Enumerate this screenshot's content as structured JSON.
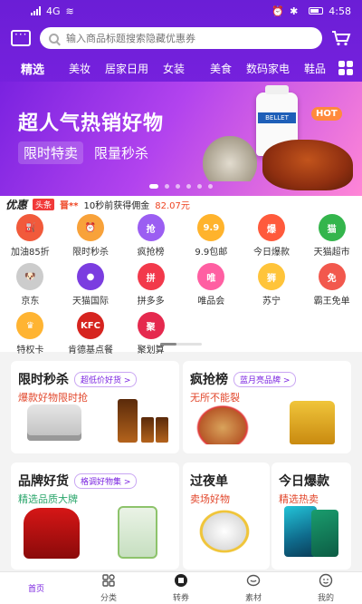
{
  "status": {
    "network": "4G",
    "battery": "",
    "time": "4:58"
  },
  "search": {
    "placeholder": "输入商品标题搜索隐藏优惠券"
  },
  "categories": [
    "精选",
    "美妆",
    "居家日用",
    "女装",
    "美食",
    "数码家电",
    "鞋品"
  ],
  "banner": {
    "title": "超人气热销好物",
    "sub1": "限时特卖",
    "sub2": "限量秒杀",
    "bottle_label": "BELLET",
    "hot": "HOT"
  },
  "notice": {
    "brand": "优惠",
    "tag": "头条",
    "user": "晋**",
    "text": "10秒前获得佣金",
    "amount": "82.07元"
  },
  "icons": [
    {
      "label": "加油85折",
      "color": "#f15a3b",
      "glyph": "⛽"
    },
    {
      "label": "限时秒杀",
      "color": "#f8a23a",
      "glyph": "⏰"
    },
    {
      "label": "疯抢榜",
      "color": "#9b5ef2",
      "glyph": "抢"
    },
    {
      "label": "9.9包邮",
      "color": "#ffb32c",
      "glyph": "9.9"
    },
    {
      "label": "今日爆款",
      "color": "#ff5a3c",
      "glyph": "爆"
    },
    {
      "label": "天猫超市",
      "color": "#34b54c",
      "glyph": "猫"
    },
    {
      "label": "京东",
      "color": "#cccccc",
      "glyph": "🐶"
    },
    {
      "label": "天猫国际",
      "color": "#7b3de0",
      "glyph": "●"
    },
    {
      "label": "拼多多",
      "color": "#f2394b",
      "glyph": "拼"
    },
    {
      "label": "唯品会",
      "color": "#ff5fa2",
      "glyph": "唯"
    },
    {
      "label": "苏宁",
      "color": "#ffc43a",
      "glyph": "狮"
    },
    {
      "label": "霸王免单",
      "color": "#f2584d",
      "glyph": "免"
    },
    {
      "label": "特权卡",
      "color": "#ffb432",
      "glyph": "♛"
    },
    {
      "label": "肯德基点餐",
      "color": "#d6241f",
      "glyph": "KFC"
    },
    {
      "label": "聚划算",
      "color": "#e5294e",
      "glyph": "聚"
    }
  ],
  "cards": {
    "flash": {
      "title": "限时秒杀",
      "pill": "超低价好货 >",
      "sub": "爆款好物限时抢"
    },
    "rush": {
      "title": "疯抢榜",
      "pill": "蓝月亮品牌 >",
      "sub": "无所不能裂"
    },
    "brand": {
      "title": "品牌好货",
      "pill": "格调好物集 >",
      "sub": "精选品质大牌"
    },
    "overnight": {
      "title": "过夜单",
      "sub": "卖场好物"
    },
    "hotday": {
      "title": "今日爆款",
      "sub": "精选热卖"
    }
  },
  "nav": [
    {
      "label": "首页",
      "icon": "home-icon",
      "active": true
    },
    {
      "label": "分类",
      "icon": "category-icon",
      "active": false
    },
    {
      "label": "转券",
      "icon": "coupon-icon",
      "active": false
    },
    {
      "label": "素材",
      "icon": "material-icon",
      "active": false
    },
    {
      "label": "我的",
      "icon": "profile-icon",
      "active": false
    }
  ],
  "colors": {
    "brand": "#7a22e0",
    "accent": "#e2482d"
  }
}
